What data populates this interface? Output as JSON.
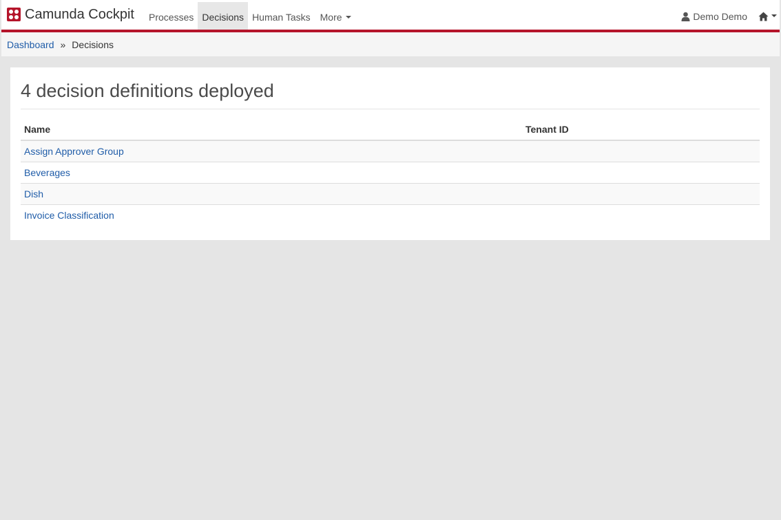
{
  "header": {
    "brand": "Camunda Cockpit",
    "brand_logo": "camunda-logo-icon",
    "nav": [
      {
        "label": "Processes",
        "active": false
      },
      {
        "label": "Decisions",
        "active": true
      },
      {
        "label": "Human Tasks",
        "active": false
      },
      {
        "label": "More",
        "active": false,
        "dropdown": true
      }
    ],
    "user": "Demo Demo",
    "user_icon": "user-icon",
    "home_icon": "home-icon",
    "accent_color": "#b5152b"
  },
  "breadcrumb": {
    "link": "Dashboard",
    "separator": "»",
    "current": "Decisions"
  },
  "main": {
    "title": "4 decision definitions deployed",
    "columns": [
      "Name",
      "Tenant ID"
    ],
    "rows": [
      {
        "name": "Assign Approver Group",
        "tenant": ""
      },
      {
        "name": "Beverages",
        "tenant": ""
      },
      {
        "name": "Dish",
        "tenant": ""
      },
      {
        "name": "Invoice Classification",
        "tenant": ""
      }
    ]
  }
}
